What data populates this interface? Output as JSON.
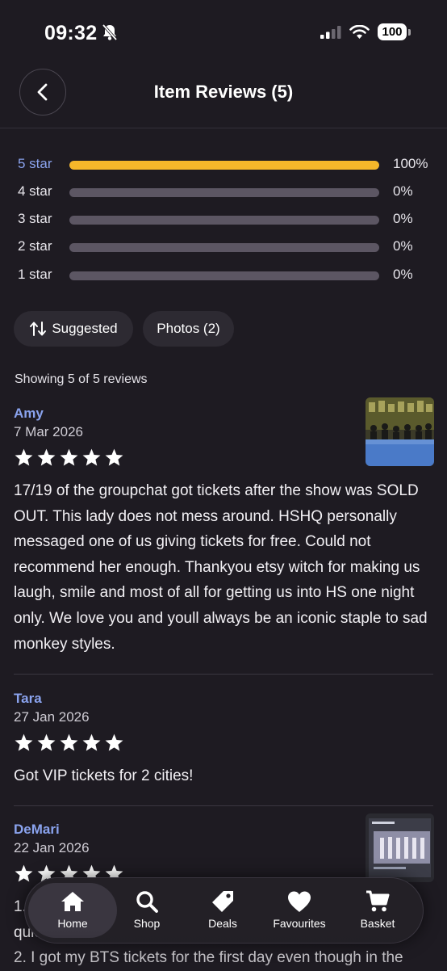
{
  "status_bar": {
    "time": "09:32",
    "battery": "100"
  },
  "header": {
    "title": "Item Reviews (5)"
  },
  "rating_breakdown": [
    {
      "label": "5 star",
      "percent_text": "100%",
      "fraction": 1.0
    },
    {
      "label": "4 star",
      "percent_text": "0%",
      "fraction": 0
    },
    {
      "label": "3 star",
      "percent_text": "0%",
      "fraction": 0
    },
    {
      "label": "2 star",
      "percent_text": "0%",
      "fraction": 0
    },
    {
      "label": "1 star",
      "percent_text": "0%",
      "fraction": 0
    }
  ],
  "filters": {
    "sort_label": "Suggested",
    "photos_label": "Photos (2)"
  },
  "showing_text": "Showing 5 of 5 reviews",
  "reviews": [
    {
      "name": "Amy",
      "date": "7 Mar 2026",
      "rating": 5,
      "text": "17/19 of the groupchat got tickets after the show was SOLD OUT. This lady does not mess around. HSHQ personally messaged one of us giving tickets for free. Could not recommend her enough. Thankyou etsy witch for making us laugh, smile and most of all for getting us into HS one night only. We love you and youll always be an iconic staple to sad monkey styles."
    },
    {
      "name": "Tara",
      "date": "27 Jan 2026",
      "rating": 5,
      "text": "Got VIP tickets for 2 cities!"
    },
    {
      "name": "DeMari",
      "date": "22 Jan 2026",
      "rating": 5,
      "text_line1": "1.",
      "text_line2": "quick",
      "text_line3": "2. I got my BTS tickets for the first day even though in the"
    }
  ],
  "tab_bar": {
    "tabs": [
      {
        "label": "Home",
        "icon": "home-icon",
        "active": true
      },
      {
        "label": "Shop",
        "icon": "search-icon"
      },
      {
        "label": "Deals",
        "icon": "tag-icon"
      },
      {
        "label": "Favourites",
        "icon": "heart-icon"
      },
      {
        "label": "Basket",
        "icon": "cart-icon"
      }
    ]
  },
  "colors": {
    "accent_star": "#f5b72a",
    "link_name": "#8aa3ee",
    "background": "#1e1b22"
  }
}
